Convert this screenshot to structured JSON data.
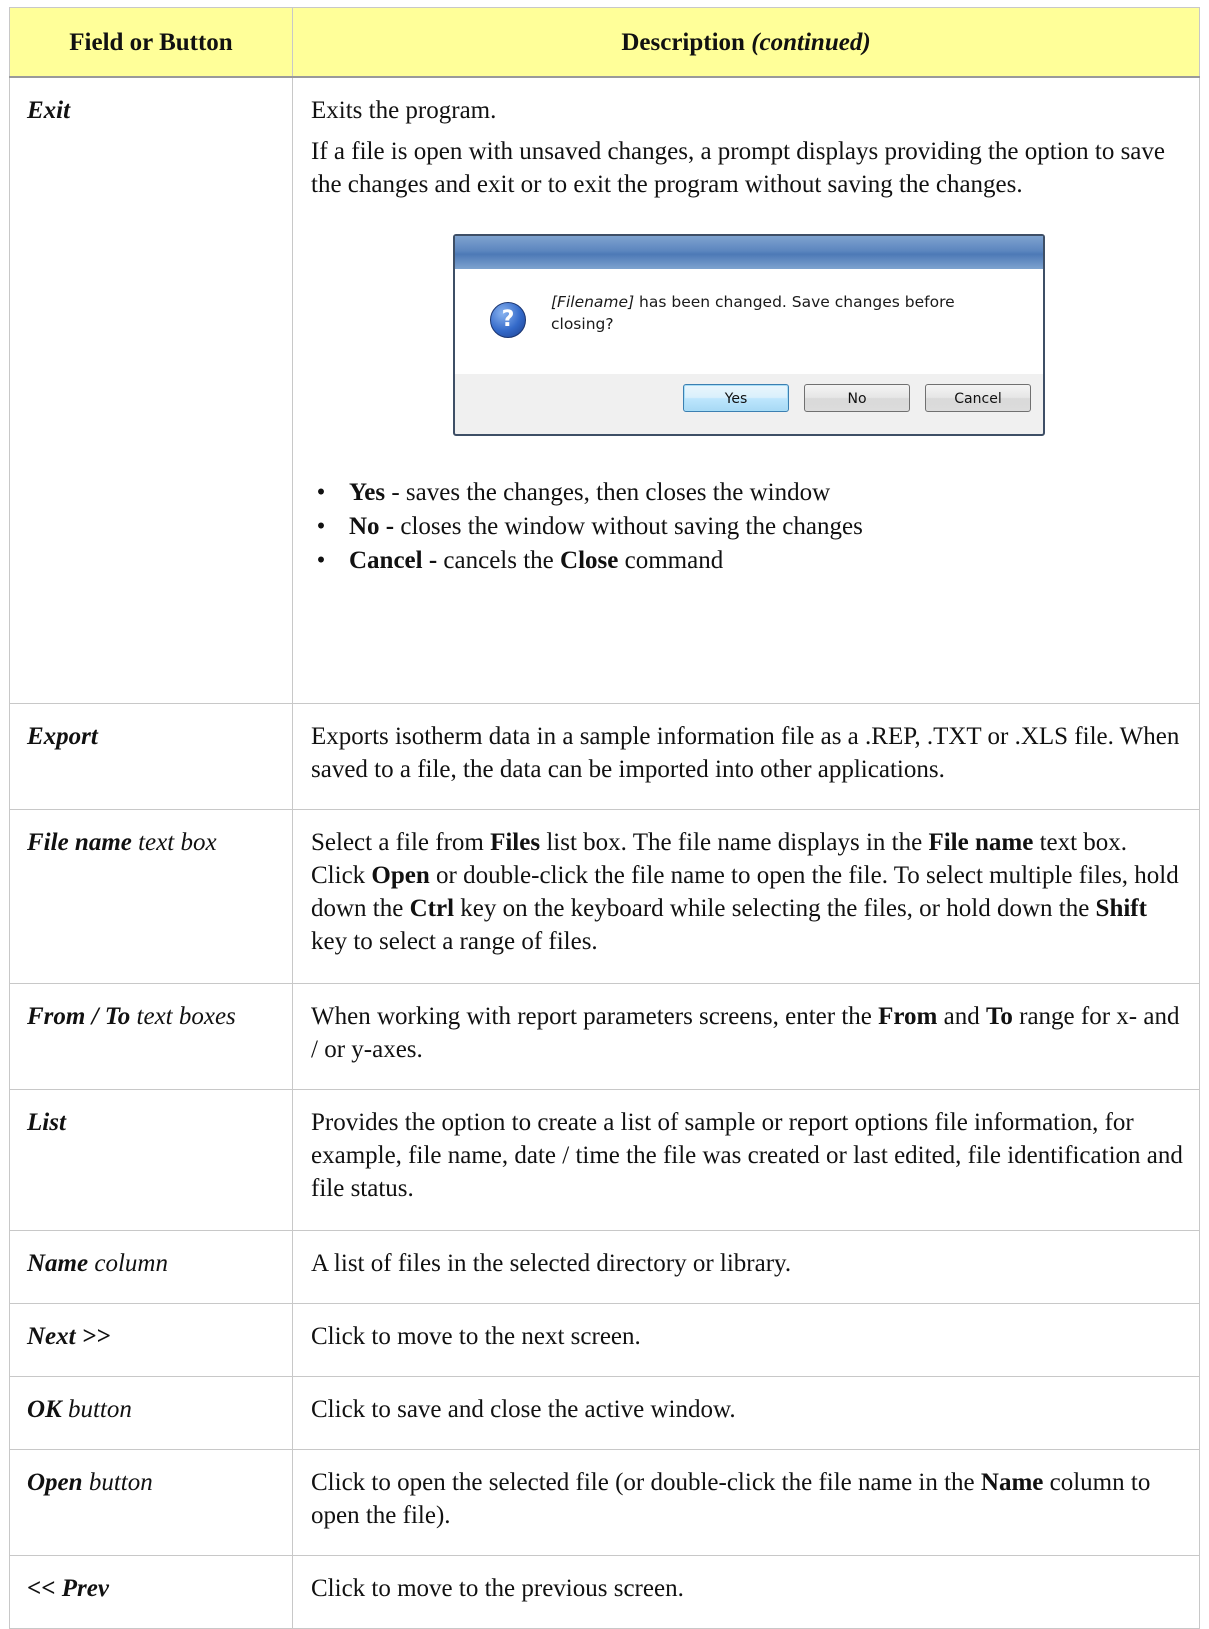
{
  "header": {
    "col1": "Field or Button",
    "col2_main": "Description",
    "col2_suffix": "(continued)"
  },
  "exit": {
    "field": "Exit",
    "p1": "Exits the program.",
    "p2": "If a file is open with unsaved changes, a prompt displays providing the option to save the changes and exit or to exit the program without saving the changes.",
    "dialog": {
      "icon": "question-icon",
      "icon_glyph": "?",
      "message_filename": "[Filename]",
      "message_rest": " has been changed. Save changes before closing?",
      "yes": "Yes",
      "no": "No",
      "cancel": "Cancel"
    },
    "bullets": [
      {
        "term": "Yes",
        "text": " - saves the changes, then closes the window"
      },
      {
        "term": "No -",
        "text": " closes the window without saving the changes"
      },
      {
        "term": "Cancel -",
        "text": " cancels the ",
        "term2": "Close",
        "text2": " command"
      }
    ]
  },
  "export": {
    "field": "Export",
    "desc": "Exports isotherm data in a sample information file as a .REP, .TXT or .XLS file. When saved to a file, the data can be imported into other applications."
  },
  "filename": {
    "field_bold": "File name",
    "field_rest": " text box",
    "d1": "Select a file from ",
    "d1b": "Files",
    "d2": " list box. The file name displays in the ",
    "d2b": "File name",
    "d3": " text box. Click ",
    "d3b": "Open",
    "d4": " or double-click the file name to open the file. To select multiple files, hold down the ",
    "d4b": "Ctrl",
    "d5": "  key on the keyboard while selecting the files, or hold down the ",
    "d5b": "Shift",
    "d6": " key to select a range of files."
  },
  "fromto": {
    "field_bold": "From / To",
    "field_rest": " text boxes",
    "d1": "When working with report parameters screens, enter the ",
    "d1b": "From",
    "d2": " and ",
    "d2b": "To",
    "d3": " range for x- and / or y-axes."
  },
  "list": {
    "field": "List",
    "desc": "Provides the option to create a list of sample or report options file information, for example, file name, date / time the file was created or last edited, file identification and file status."
  },
  "namecol": {
    "field_bold": "Name",
    "field_rest": " column",
    "desc": "A list of files in the selected directory or library."
  },
  "next": {
    "field": "Next >>",
    "desc": "Click to move to the next screen."
  },
  "ok": {
    "field_bold": "OK",
    "field_rest": " button",
    "desc": "Click to save and close the active window."
  },
  "open": {
    "field_bold": "Open",
    "field_rest": " button",
    "d1": "Click to open the selected file (or double-click the file name in the ",
    "d1b": "Name",
    "d2": " column to open the file)."
  },
  "prev": {
    "field": "<< Prev",
    "desc": "Click to move to the previous screen."
  }
}
